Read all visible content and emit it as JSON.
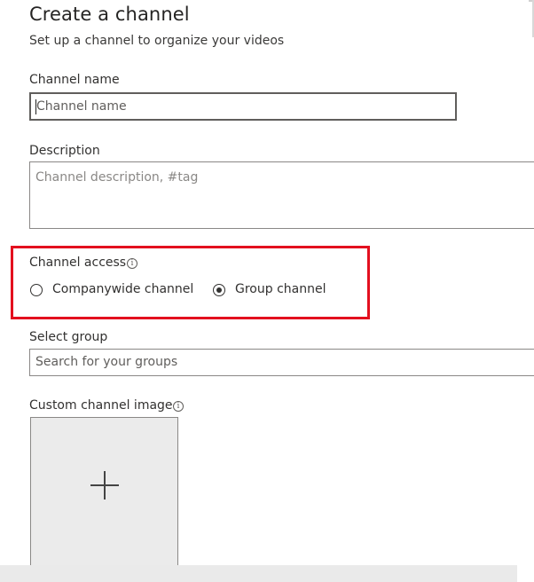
{
  "header": {
    "title": "Create a channel",
    "subtitle": "Set up a channel to organize your videos"
  },
  "channel_name": {
    "label": "Channel name",
    "placeholder": "Channel name"
  },
  "description": {
    "label": "Description",
    "placeholder": "Channel description, #tag"
  },
  "channel_access": {
    "label": "Channel access",
    "info_icon": "info-icon",
    "options": [
      {
        "label": "Companywide channel",
        "selected": false
      },
      {
        "label": "Group channel",
        "selected": true
      }
    ]
  },
  "select_group": {
    "label": "Select group",
    "placeholder": "Search for your groups"
  },
  "custom_image": {
    "label": "Custom channel image",
    "info_icon": "info-icon",
    "add_icon": "plus-icon"
  },
  "colors": {
    "highlight": "#e3101f",
    "text": "#323130",
    "image_bg": "#ebebeb"
  }
}
